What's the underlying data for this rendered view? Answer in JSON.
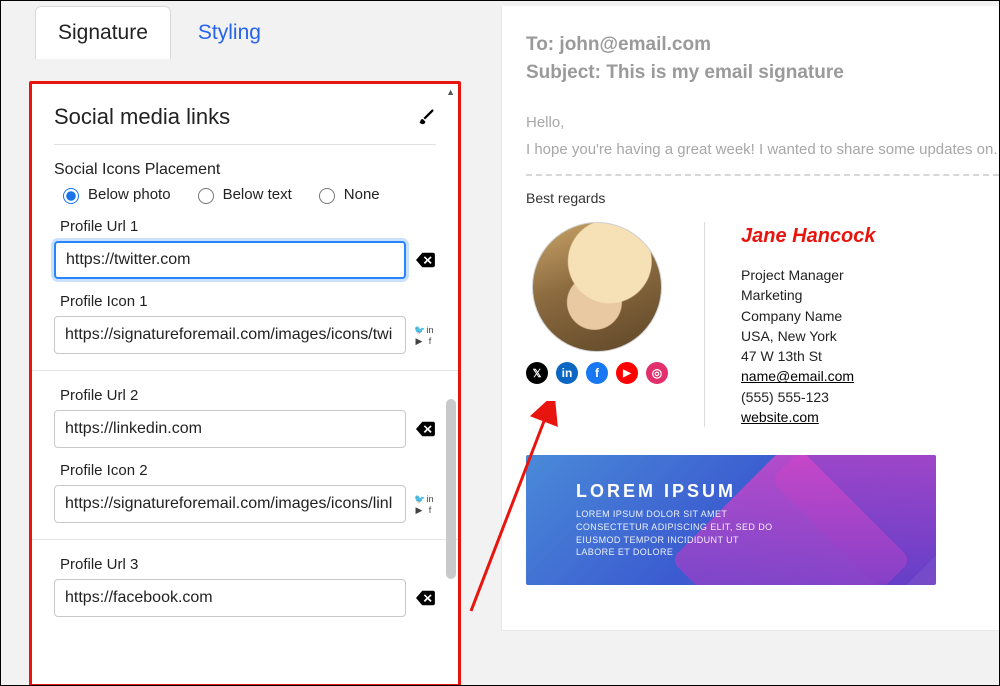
{
  "tabs": {
    "signature": "Signature",
    "styling": "Styling"
  },
  "section": {
    "title": "Social media links"
  },
  "placement": {
    "label": "Social Icons Placement",
    "options": {
      "below_photo": "Below photo",
      "below_text": "Below text",
      "none": "None"
    },
    "selected": "below_photo"
  },
  "profiles": [
    {
      "url_label": "Profile Url 1",
      "url_value": "https://twitter.com",
      "icon_label": "Profile Icon 1",
      "icon_value": "https://signatureforemail.com/images/icons/twi"
    },
    {
      "url_label": "Profile Url 2",
      "url_value": "https://linkedin.com",
      "icon_label": "Profile Icon 2",
      "icon_value": "https://signatureforemail.com/images/icons/linl"
    },
    {
      "url_label": "Profile Url 3",
      "url_value": "https://facebook.com"
    }
  ],
  "preview": {
    "to_label": "To:",
    "to_value": "john@email.com",
    "subject_label": "Subject:",
    "subject_value": "This is my email signature",
    "greeting": "Hello,",
    "line": "I hope you're having a great week! I wanted to share some updates on.",
    "regards": "Best regards"
  },
  "signature": {
    "name": "Jane Hancock",
    "role": "Project Manager",
    "dept": "Marketing",
    "company": "Company Name",
    "loc": "USA, New York",
    "street": "47 W 13th St",
    "email": "name@email.com",
    "phone": "(555) 555-123",
    "site": "website.com"
  },
  "banner": {
    "title": "LOREM IPSUM",
    "sub": "LOREM IPSUM DOLOR SIT AMET CONSECTETUR ADIPISCING ELIT, SED DO EIUSMOD TEMPOR INCIDIDUNT UT LABORE ET DOLORE"
  }
}
